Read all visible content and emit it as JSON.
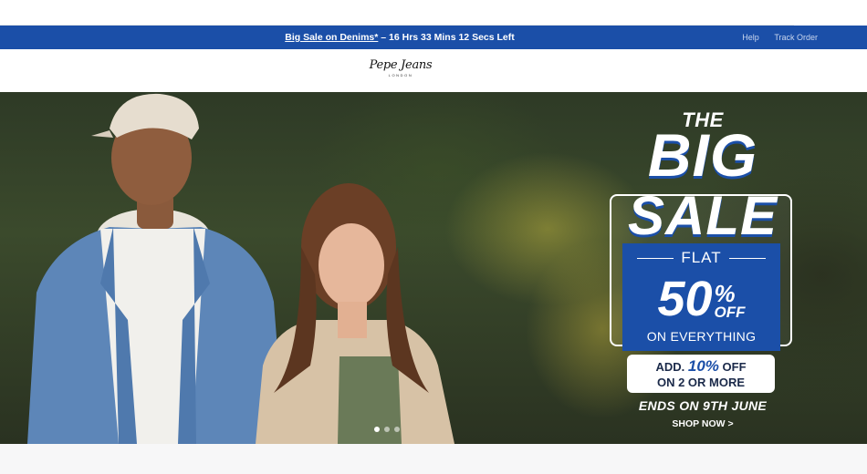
{
  "announcement": {
    "link_text": "Big Sale on Denims*",
    "countdown": " – 16 Hrs 33 Mins 12 Secs Left",
    "background": "#1b4fa8"
  },
  "utility_links": {
    "help": "Help",
    "track_order": "Track Order"
  },
  "brand": {
    "logo_text": "Pepe Jeans",
    "logo_subtext": "LONDON"
  },
  "hero_banner": {
    "headline_the": "THE",
    "headline_big": "BIG",
    "headline_sale": "SALE",
    "flat": "FLAT",
    "discount_number": "50",
    "discount_symbol": "%",
    "discount_off": "OFF",
    "on_everything": "ON EVERYTHING",
    "extra_prefix": "ADD.",
    "extra_percent": "10%",
    "extra_suffix": "OFF",
    "extra_condition": "ON 2 OR MORE",
    "ends": "ENDS ON 9TH JUNE",
    "cta": "SHOP NOW >",
    "accent_color": "#1b4fa8",
    "slide_count": 3,
    "active_slide": 1
  }
}
